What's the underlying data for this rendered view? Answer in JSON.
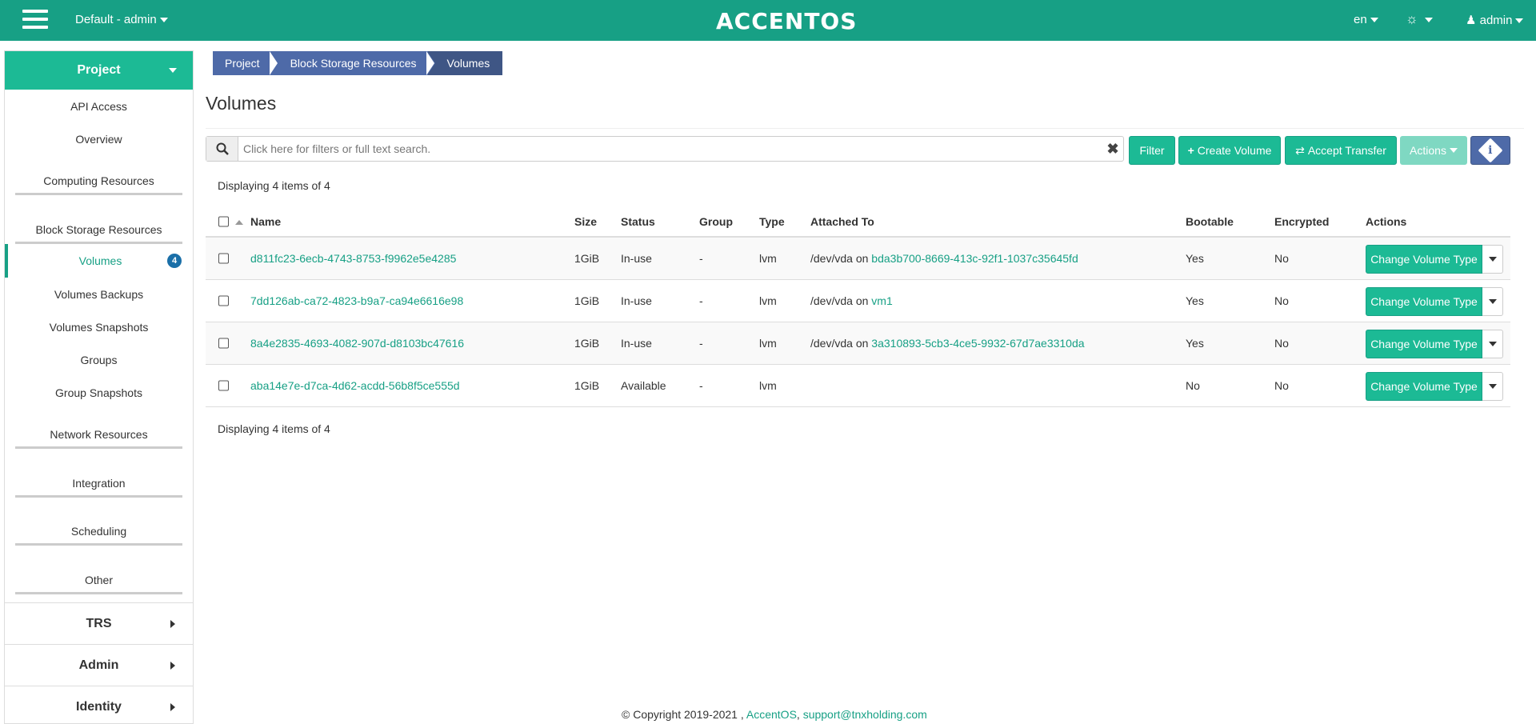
{
  "topbar": {
    "project_switch": "Default - admin",
    "logo": "ACCENTOS",
    "lang": "en",
    "user": "admin"
  },
  "sidebar": {
    "project": "Project",
    "items": [
      {
        "label": "API Access"
      },
      {
        "label": "Overview"
      },
      {
        "label": "Computing Resources"
      },
      {
        "label": "Block Storage Resources"
      },
      {
        "label": "Volumes",
        "badge": "4"
      },
      {
        "label": "Volumes Backups"
      },
      {
        "label": "Volumes Snapshots"
      },
      {
        "label": "Groups"
      },
      {
        "label": "Group Snapshots"
      },
      {
        "label": "Network Resources"
      },
      {
        "label": "Integration"
      },
      {
        "label": "Scheduling"
      },
      {
        "label": "Other"
      }
    ],
    "sections": [
      "TRS",
      "Admin",
      "Identity"
    ]
  },
  "breadcrumb": [
    "Project",
    "Block Storage Resources",
    "Volumes"
  ],
  "page_title": "Volumes",
  "toolbar": {
    "search_placeholder": "Click here for filters or full text search.",
    "filter": "Filter",
    "create_volume": "Create Volume",
    "accept_transfer": "Accept Transfer",
    "actions": "Actions"
  },
  "display_count": "Displaying 4 items of 4",
  "table": {
    "headers": [
      "Name",
      "Size",
      "Status",
      "Group",
      "Type",
      "Attached To",
      "Bootable",
      "Encrypted",
      "Actions"
    ],
    "attached_on": "on",
    "rows": [
      {
        "name": "d811fc23-6ecb-4743-8753-f9962e5e4285",
        "size": "1GiB",
        "status": "In-use",
        "group": "-",
        "type": "lvm",
        "device": "/dev/vda",
        "instance": "bda3b700-8669-413c-92f1-1037c35645fd",
        "bootable": "Yes",
        "encrypted": "No",
        "action": "Change Volume Type"
      },
      {
        "name": "7dd126ab-ca72-4823-b9a7-ca94e6616e98",
        "size": "1GiB",
        "status": "In-use",
        "group": "-",
        "type": "lvm",
        "device": "/dev/vda",
        "instance": "vm1",
        "bootable": "Yes",
        "encrypted": "No",
        "action": "Change Volume Type"
      },
      {
        "name": "8a4e2835-4693-4082-907d-d8103bc47616",
        "size": "1GiB",
        "status": "In-use",
        "group": "-",
        "type": "lvm",
        "device": "/dev/vda",
        "instance": "3a310893-5cb3-4ce5-9932-67d7ae3310da",
        "bootable": "Yes",
        "encrypted": "No",
        "action": "Change Volume Type"
      },
      {
        "name": "aba14e7e-d7ca-4d62-acdd-56b8f5ce555d",
        "size": "1GiB",
        "status": "Available",
        "group": "-",
        "type": "lvm",
        "device": "",
        "instance": "",
        "bootable": "No",
        "encrypted": "No",
        "action": "Change Volume Type"
      }
    ]
  },
  "footer": {
    "copyright": "© Copyright 2019-2021 ,",
    "brand": "AccentOS",
    "separator": ",",
    "email": "support@tnxholding.com"
  }
}
